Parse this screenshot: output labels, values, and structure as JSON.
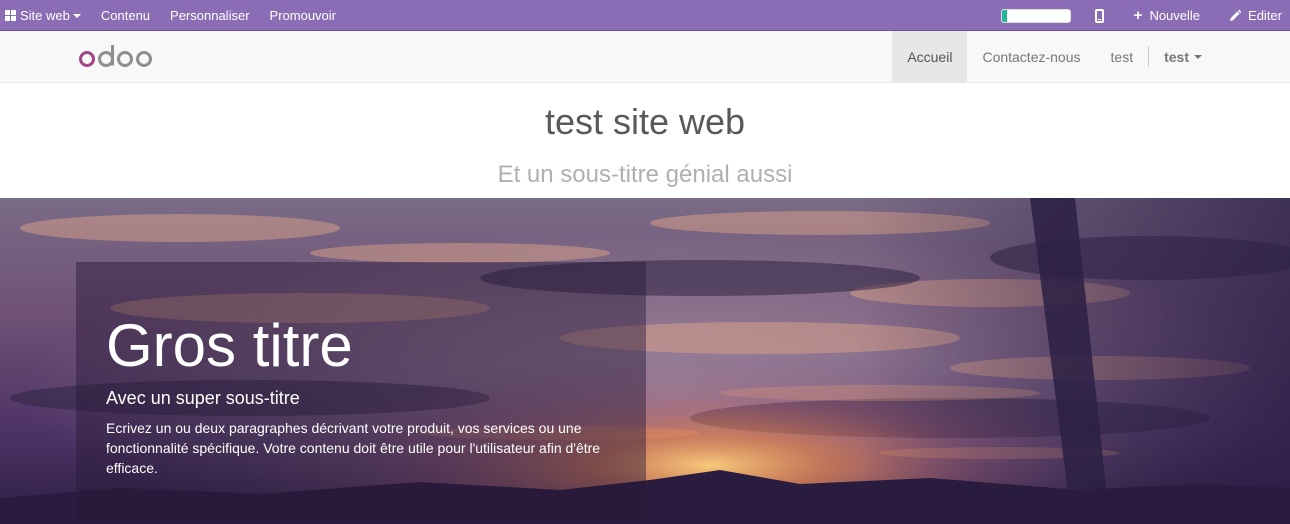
{
  "editor_bar": {
    "site_menu_label": "Site web",
    "menu_items": [
      "Contenu",
      "Personnaliser",
      "Promouvoir"
    ],
    "progress": 0.08,
    "new_label": "Nouvelle",
    "edit_label": "Editer",
    "colors": {
      "bar": "#8a6db5",
      "progress": "#21b799"
    }
  },
  "navbar": {
    "logo_text": "odoo",
    "items": [
      "Accueil",
      "Contactez-nous",
      "test"
    ],
    "active_item": "Accueil",
    "user_label": "test"
  },
  "header": {
    "title": "test site web",
    "subtitle": "Et un sous-titre génial aussi"
  },
  "hero": {
    "title": "Gros titre",
    "subtitle": "Avec un super sous-titre",
    "text": "Ecrivez un ou deux paragraphes décrivant votre produit, vos services ou une fonctionnalité spécifique. Votre contenu doit être utile pour l'utilisateur afin d'être efficace."
  }
}
